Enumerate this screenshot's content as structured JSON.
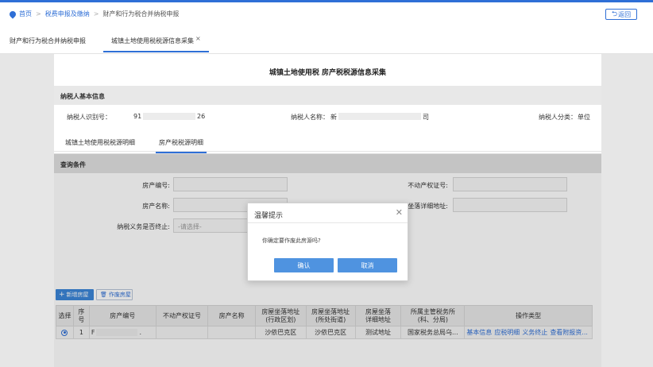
{
  "breadcrumb": {
    "home": "首页",
    "level1": "税费申报及缴纳",
    "current": "财产和行为税合并纳税申报"
  },
  "header": {
    "back_label": "返回"
  },
  "tabs": [
    {
      "label": "财产和行为税合并纳税申报"
    },
    {
      "label": "城镇土地使用税税源信息采集"
    }
  ],
  "page": {
    "title": "城镇土地使用税 房产税税源信息采集"
  },
  "taxpayer": {
    "section_title": "纳税人基本信息",
    "id_label": "纳税人识别号：",
    "id_prefix": "91",
    "id_suffix": "26",
    "name_label": "纳税人名称：",
    "name_prefix": "新",
    "name_suffix": "司",
    "type_label": "纳税人分类：",
    "type_value": "单位"
  },
  "subtabs": [
    {
      "label": "城镇土地使用税税源明细"
    },
    {
      "label": "房产税税源明细"
    }
  ],
  "query": {
    "section_title": "查询条件",
    "property_no_label": "房产编号:",
    "cert_no_label": "不动产权证号:",
    "property_name_label": "房产名称:",
    "address_label": "房屋坐落详细地址:",
    "end_label": "纳税义务是否终止:",
    "end_placeholder": "-请选择-"
  },
  "actions": {
    "add_label": "新增房屋",
    "void_label": "作废房屋"
  },
  "table": {
    "headers": {
      "select": "选择",
      "seq": "序号",
      "property_no": "房产编号",
      "cert_no": "不动产权证号",
      "name": "房产名称",
      "addr_admin_1": "房屋坐落地址",
      "addr_admin_2": "(行政区划)",
      "addr_street_1": "房屋坐落地址",
      "addr_street_2": "(所处街道)",
      "addr_detail_1": "房屋坐落",
      "addr_detail_2": "详细地址",
      "office_1": "所属主管税务所",
      "office_2": "(科、分局)",
      "ops": "操作类型"
    },
    "rows": [
      {
        "seq": "1",
        "property_no_prefix": "F",
        "property_no_suffix": ".",
        "cert_no": "",
        "name": "",
        "addr_admin": "沙依巴克区",
        "addr_street": "沙依巴克区",
        "addr_detail": "测试地址",
        "office": "国家税务总局乌...",
        "op_basic": "基本信息",
        "op_detail": "应税明细",
        "op_end": "义务终止",
        "op_attach": "查看附报资..."
      }
    ]
  },
  "dialog": {
    "title": "温馨提示",
    "message": "你确定要作废此房源吗?",
    "confirm": "确认",
    "cancel": "取消"
  },
  "colors": {
    "accent": "#2f6fd6",
    "dialog_button": "#4f93e0"
  }
}
